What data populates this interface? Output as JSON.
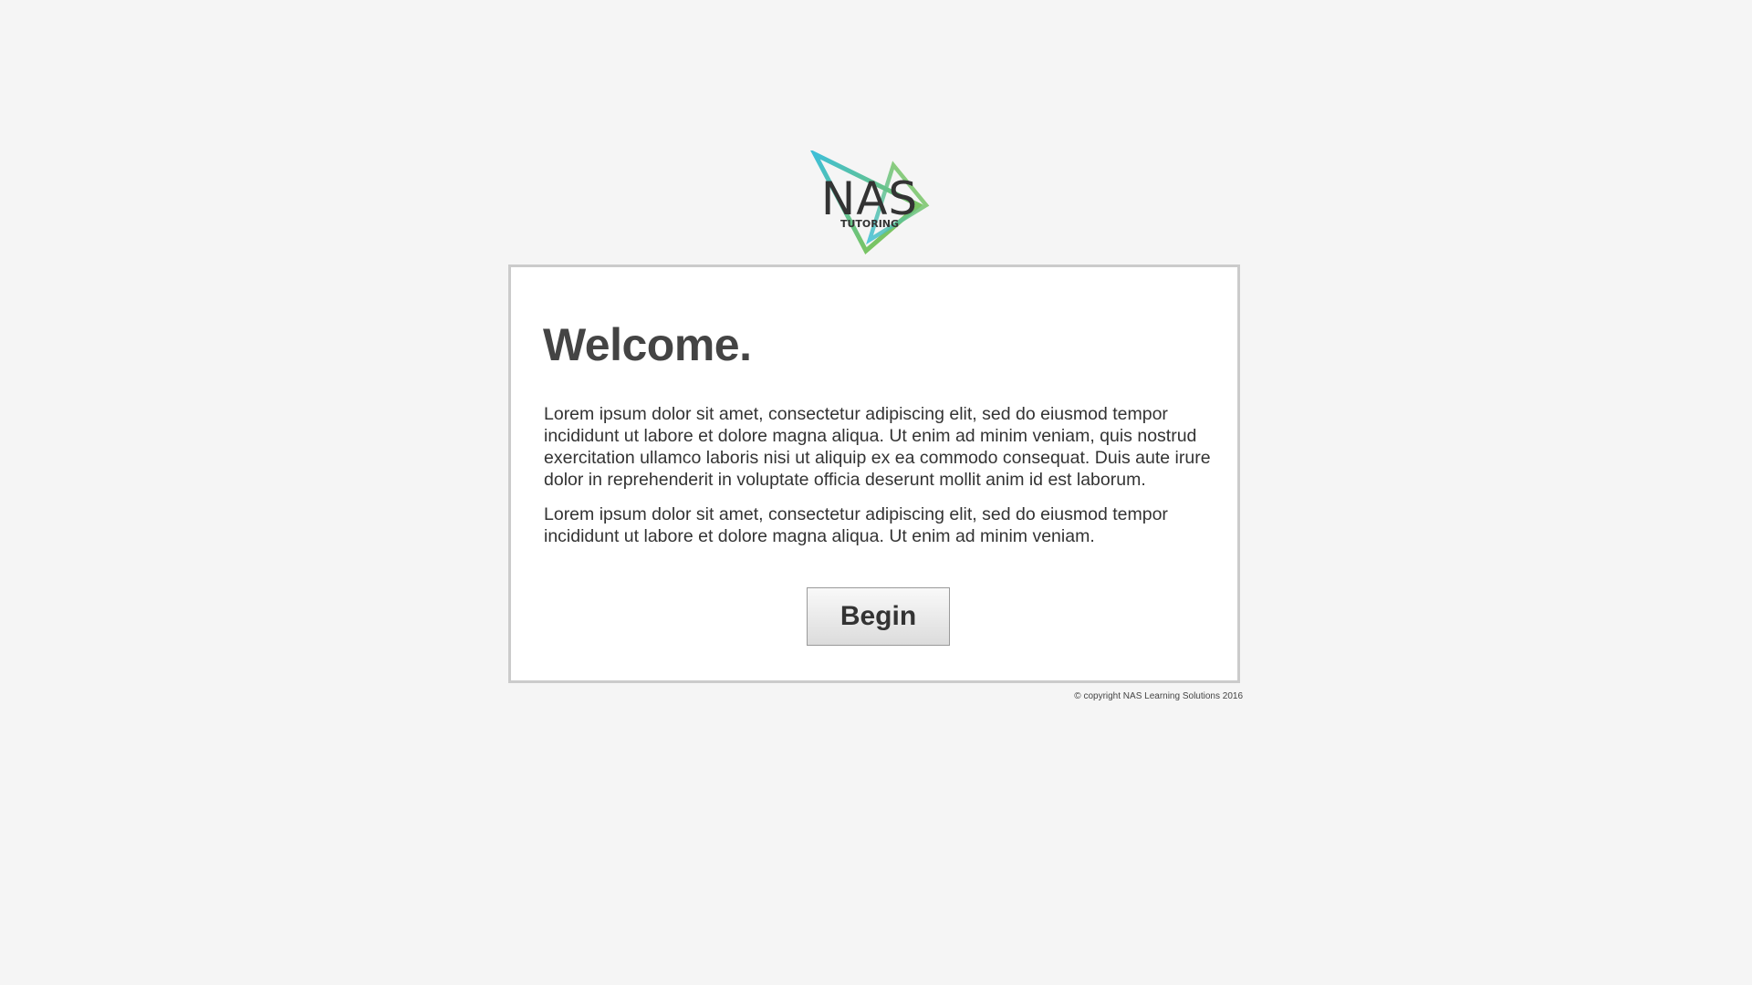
{
  "logo": {
    "wordmark": "NAS",
    "tagline": "TUTORING",
    "colors": {
      "blue": "#3fbfd6",
      "green": "#8cc63f",
      "text": "#333333"
    }
  },
  "card": {
    "heading": "Welcome.",
    "paragraphs": [
      "Lorem ipsum dolor sit amet, consectetur adipiscing elit, sed do eiusmod tempor incididunt ut labore et dolore magna aliqua. Ut enim ad minim veniam, quis nostrud exercitation ullamco laboris nisi ut aliquip ex ea commodo consequat. Duis aute irure dolor in reprehenderit in voluptate officia deserunt mollit anim id est laborum.",
      "Lorem ipsum dolor sit amet, consectetur adipiscing elit, sed do eiusmod tempor incididunt ut labore et dolore magna aliqua. Ut enim ad minim veniam."
    ],
    "begin_label": "Begin"
  },
  "footer": {
    "copyright": "© copyright NAS Learning Solutions 2016"
  }
}
